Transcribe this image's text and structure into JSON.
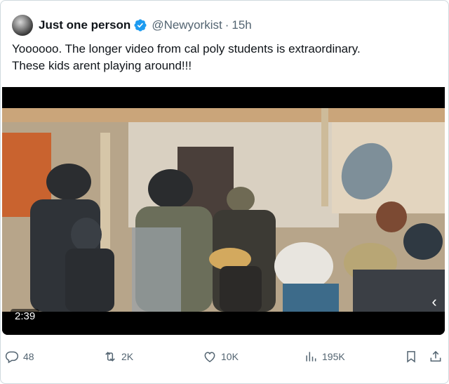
{
  "tweet": {
    "display_name": "Just one person",
    "handle": "@Newyorkist",
    "separator": "·",
    "time": "15h",
    "verified": true,
    "text": "Yoooooo. The longer video from cal poly students is extraordinary.\nThese kids arent playing around!!!"
  },
  "media": {
    "duration": "2:39",
    "next_icon": "chevron-right-icon"
  },
  "actions": {
    "replies": "48",
    "reposts": "2K",
    "likes": "10K",
    "views": "195K"
  },
  "colors": {
    "accent": "#1d9bf0",
    "text_primary": "#0f1419",
    "text_secondary": "#536471",
    "border": "#cfd9de"
  }
}
